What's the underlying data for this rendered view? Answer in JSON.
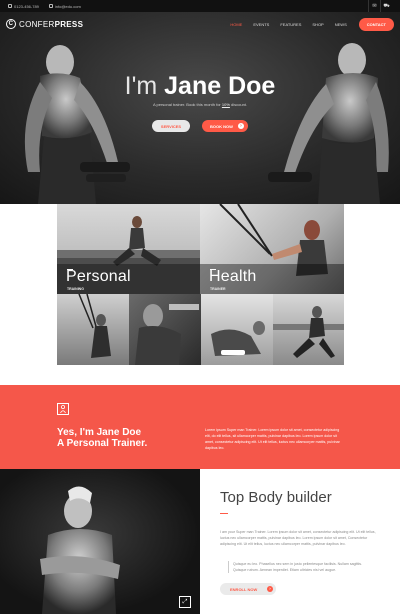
{
  "topbar": {
    "phone": "0123-456-789",
    "email": "info@edu.com",
    "mail_icon": "mail-icon",
    "cart_icon": "cart-icon"
  },
  "nav": {
    "brand_light": "CONFER",
    "brand_bold": "PRESS",
    "logo_letter": "C",
    "items": [
      {
        "label": "HOME",
        "active": true
      },
      {
        "label": "EVENTS",
        "active": false
      },
      {
        "label": "FEATURES",
        "active": false
      },
      {
        "label": "SHOP",
        "active": false
      },
      {
        "label": "NEWS",
        "active": false
      }
    ],
    "contact_label": "CONTACT"
  },
  "hero": {
    "title_light": "I'm ",
    "title_bold": "Jane Doe",
    "subtitle_pre": "A personal trainer. Book this month for ",
    "subtitle_link": "10%",
    "subtitle_post": " discount.",
    "services_label": "SERVICES",
    "book_label": "BOOK NOW"
  },
  "gallery": {
    "tiles": [
      {
        "title": "Personal",
        "sub": "TRAINING"
      },
      {
        "title": "Health",
        "sub": "TRAINER"
      }
    ]
  },
  "intro": {
    "line1": "Yes, I'm Jane Doe",
    "line2": "A Personal Trainer.",
    "text": "Lorem ipsum Super man Trainer. Lorem ipsum dolor sit amet, consectetur adipiscing elit, do elit tellus, sit ullamcorper mattis, pulvinar dapibus leo. Lorem ipsum dolor sit amet, consectetur adipiscing elit. Ut elit tellus, luctus nec ullamcorper mattis, pulvinar dapibus leo."
  },
  "about": {
    "title": "Top Body builder",
    "text": "I am your Super man Trainer. Lorem ipsum dolor sit amet, consectetur adipiscing elit. Ut elit tellus, luctus nec ullamcorper mattis, pulvinar dapibus leo. Lorem ipsum dolor sit amet, Consectetur adipiscing elit. Ut elit tellus, luctus nec ullamcorper mattis, pulvinar dapibus leo.",
    "quote": "Quisque eu leo. Phasellus nec sem in justo pellentesque facilisis. Nullam sagittis. Quisque rutrum. Aenean imperdiet. Etiam ultricies nisi vel augue.",
    "enroll_label": "ENROLL NOW"
  },
  "colors": {
    "accent": "#ff5a47",
    "red_section": "#f5574a",
    "dark": "#111111"
  }
}
